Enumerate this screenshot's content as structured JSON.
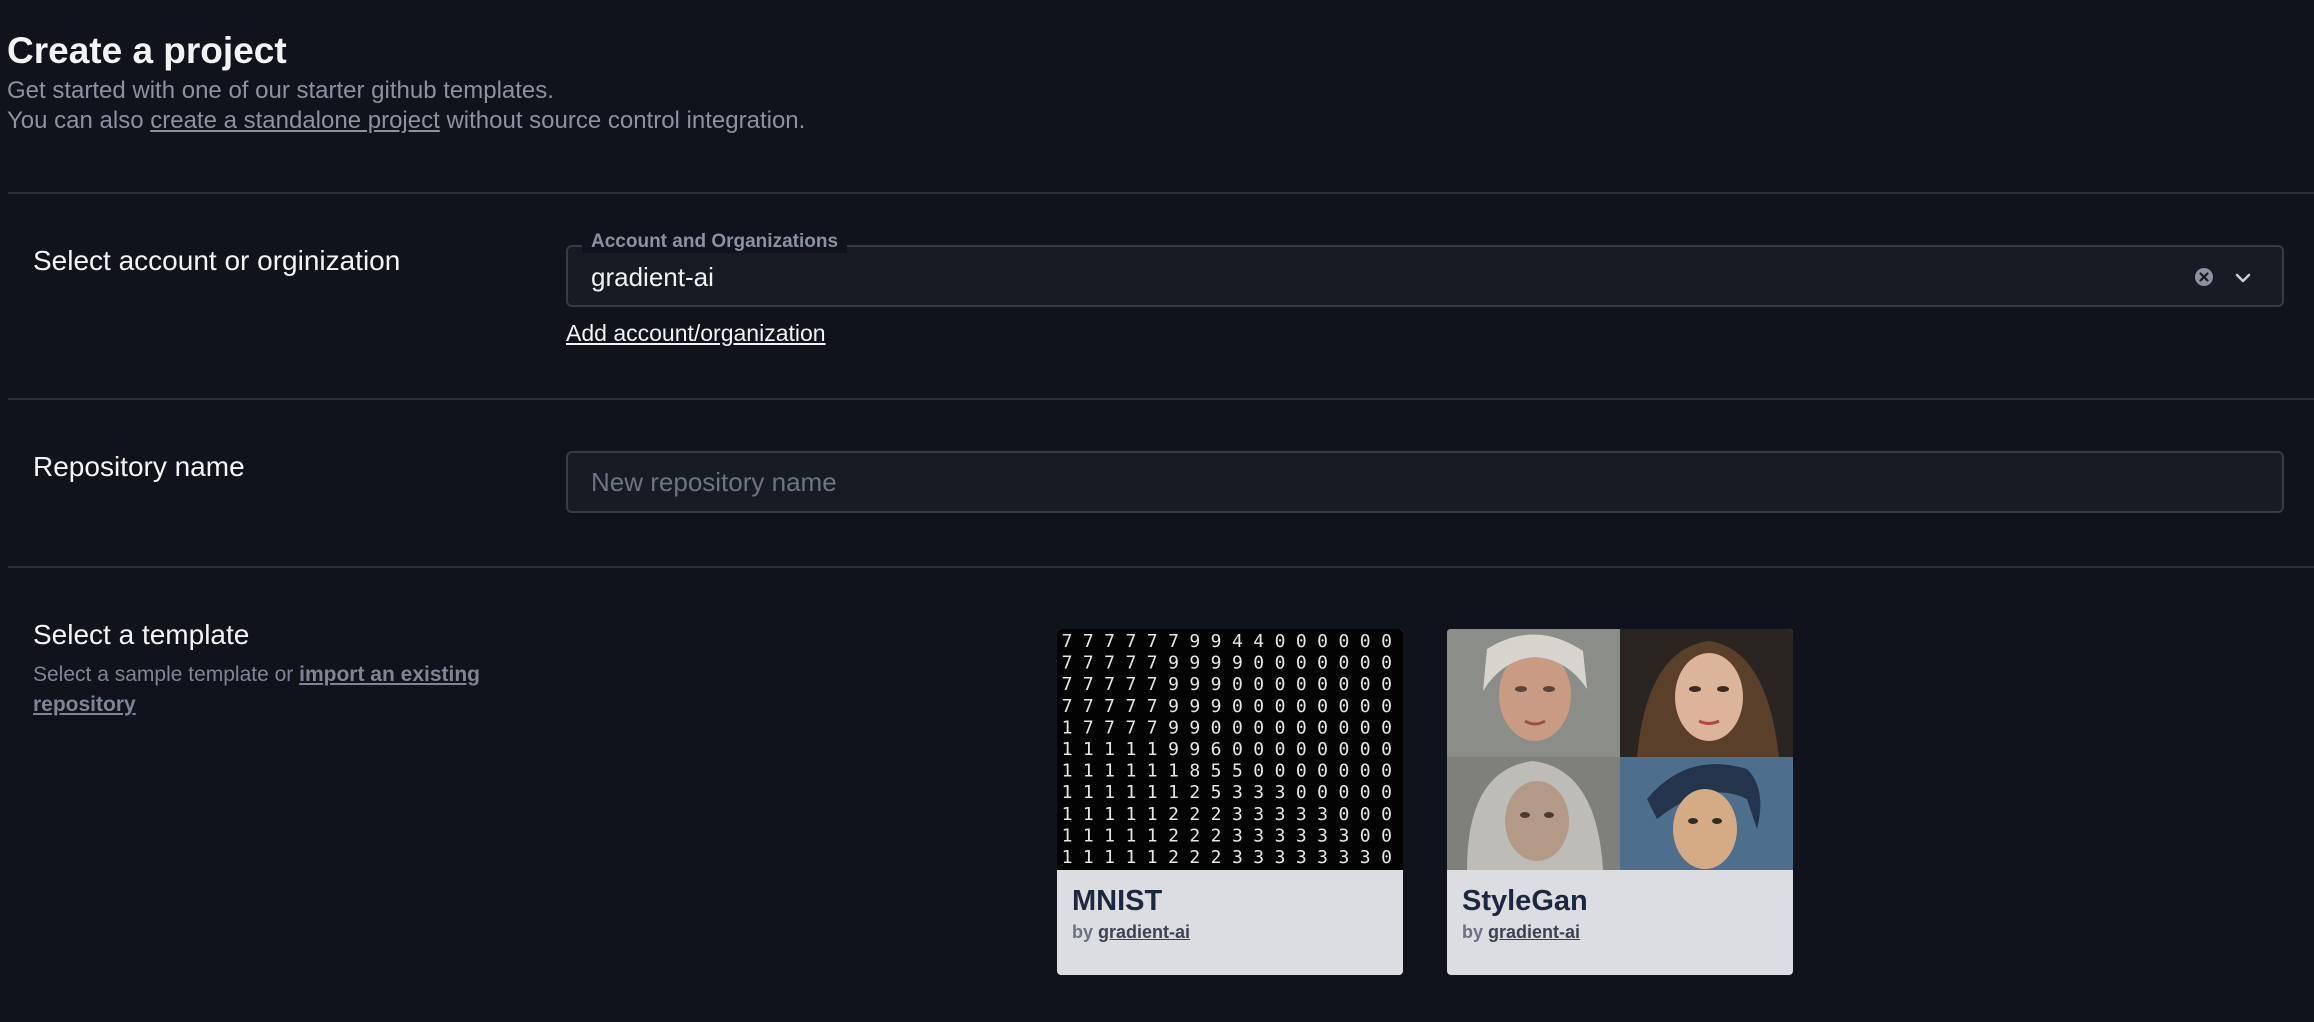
{
  "header": {
    "title": "Create a project",
    "subtitle_line1": "Get started with one of our starter github templates.",
    "subtitle_prefix": "You can also",
    "standalone_link": "create a standalone project",
    "subtitle_suffix": "without source control integration."
  },
  "account_section": {
    "label": "Select account or orginization",
    "field_legend": "Account and Organizations",
    "selected_value": "gradient-ai",
    "add_link": "Add account/organization"
  },
  "repository_section": {
    "label": "Repository name",
    "placeholder": "New repository name",
    "value": ""
  },
  "template_section": {
    "label": "Select a template",
    "sublabel_prefix": "Select a sample template or",
    "import_link": "import an existing repository",
    "templates": [
      {
        "title": "MNIST",
        "by_prefix": "by",
        "author": "gradient-ai",
        "image": "mnist-digits-grid"
      },
      {
        "title": "StyleGan",
        "by_prefix": "by",
        "author": "gradient-ai",
        "image": "stylegan-portraits-grid"
      }
    ]
  },
  "colors": {
    "background": "#10131b",
    "field_background": "#171b23",
    "card_background": "#dcdde1",
    "card_title": "#1d2740",
    "muted_text": "#8b93a2"
  }
}
